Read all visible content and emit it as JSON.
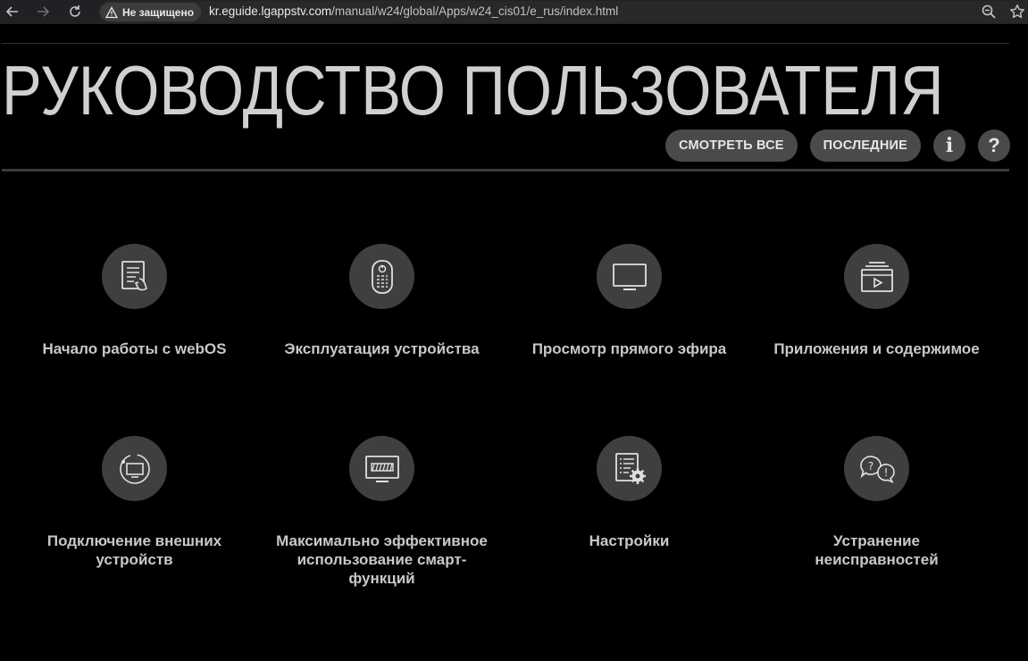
{
  "browser": {
    "security_label": "Не защищено",
    "url_host": "kr.eguide.lgappstv.com",
    "url_path": "/manual/w24/global/Apps/w24_cis01/e_rus/index.html"
  },
  "page": {
    "title": "РУКОВОДСТВО ПОЛЬЗОВАТЕЛЯ",
    "actions": {
      "view_all": "СМОТРЕТЬ ВСЕ",
      "recent": "ПОСЛЕДНИЕ",
      "info": "i",
      "help": "?"
    }
  },
  "categories": [
    {
      "label": "Начало работы с webOS",
      "icon": "document-touch-icon"
    },
    {
      "label": "Эксплуатация устройства",
      "icon": "remote-control-icon"
    },
    {
      "label": "Просмотр прямого эфира",
      "icon": "tv-icon"
    },
    {
      "label": "Приложения и содержимое",
      "icon": "media-app-icon"
    },
    {
      "label": "Подключение внешних устройств",
      "icon": "tv-connect-icon"
    },
    {
      "label": "Максимально эффективное использование смарт-функций",
      "icon": "smart-display-icon"
    },
    {
      "label": "Настройки",
      "icon": "settings-document-icon"
    },
    {
      "label": "Устранение неисправностей",
      "icon": "troubleshoot-bubbles-icon"
    }
  ]
}
